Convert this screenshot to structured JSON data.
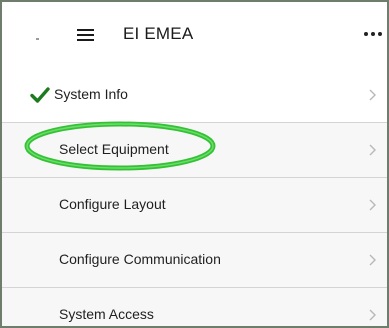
{
  "header": {
    "title": "EI EMEA",
    "menu_icon": "hamburger-menu-icon",
    "more_icon": "more-horizontal-icon"
  },
  "menu": {
    "items": [
      {
        "label": "System Info",
        "completed": true,
        "icon": "checkmark-icon"
      },
      {
        "label": "Select Equipment",
        "completed": false,
        "highlighted": true
      },
      {
        "label": "Configure Layout",
        "completed": false
      },
      {
        "label": "Configure Communication",
        "completed": false
      },
      {
        "label": "System Access",
        "completed": false
      }
    ],
    "chevron_icon": "chevron-right-icon"
  },
  "colors": {
    "check": "#1e7a1e",
    "highlight_ring": "#34c234",
    "chevron": "#b8b8b8",
    "frame_border": "#6e7d6c"
  }
}
